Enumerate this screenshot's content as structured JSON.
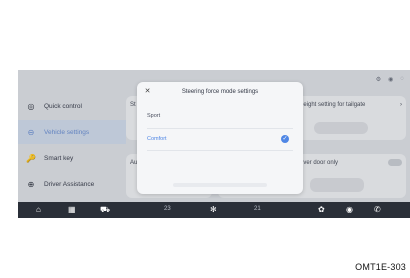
{
  "sidebar": {
    "items": [
      {
        "label": "Quick control",
        "icon": "steering-wheel-icon"
      },
      {
        "label": "Vehicle settings",
        "icon": "car-icon",
        "active": true
      },
      {
        "label": "Smart key",
        "icon": "key-icon"
      },
      {
        "label": "Driver Assistance",
        "icon": "steering-icon"
      }
    ]
  },
  "cards": {
    "tailgate_label": "height setting for tailgate",
    "driver_door_label": "river door only",
    "left_card_label_1": "St",
    "left_card_label_2": "Au"
  },
  "modal": {
    "title": "Steering force mode settings",
    "options": [
      "Sport",
      "Comfort"
    ],
    "selected": "Comfort",
    "close_icon": "close-icon"
  },
  "bottom_bar": {
    "left_temp": "23",
    "right_temp": "21"
  },
  "caption": "OMT1E-303",
  "colors": {
    "accent": "#4f86e5",
    "bar": "#2a2f38"
  }
}
